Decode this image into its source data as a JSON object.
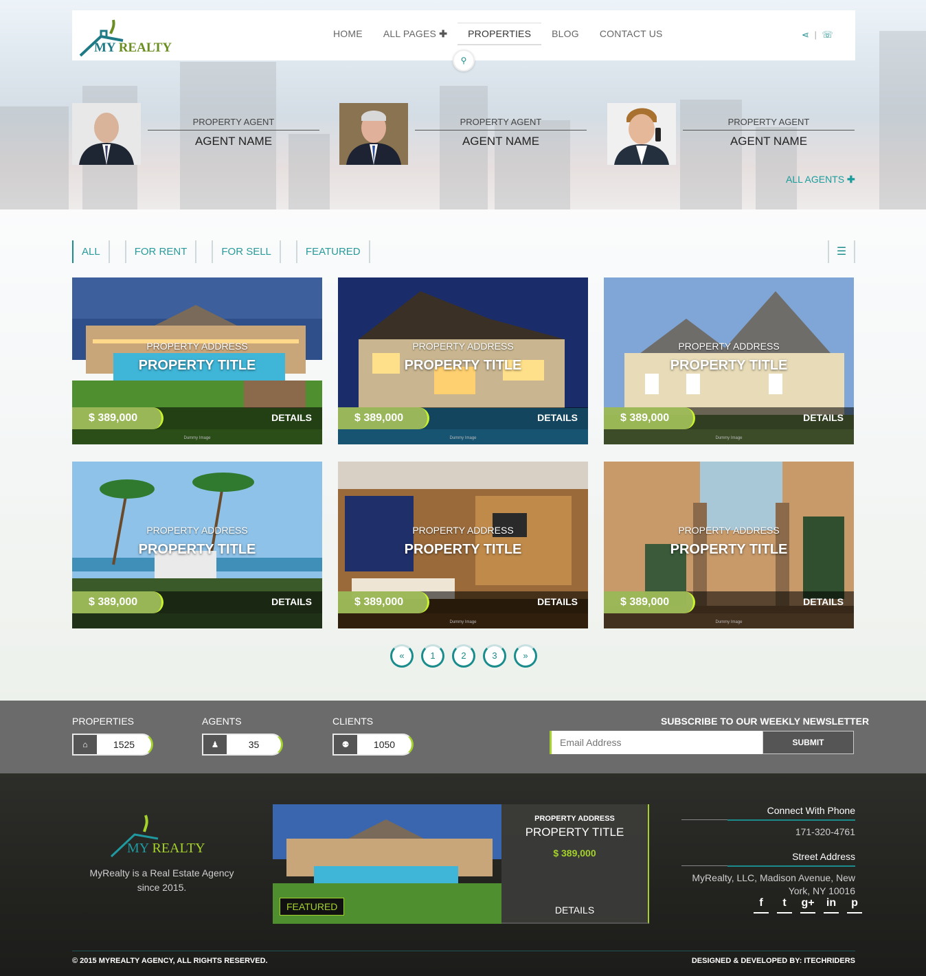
{
  "brand": {
    "name_my": "MY",
    "name_realty": "REALTY"
  },
  "nav": {
    "items": [
      {
        "label": "HOME"
      },
      {
        "label": "ALL PAGES",
        "has_plus": true
      },
      {
        "label": "PROPERTIES",
        "active": true
      },
      {
        "label": "BLOG"
      },
      {
        "label": "CONTACT US"
      }
    ],
    "divider": "|"
  },
  "agents": [
    {
      "role": "PROPERTY AGENT",
      "name": "AGENT NAME"
    },
    {
      "role": "PROPERTY AGENT",
      "name": "AGENT NAME"
    },
    {
      "role": "PROPERTY AGENT",
      "name": "AGENT NAME"
    }
  ],
  "all_agents": {
    "label": "ALL AGENTS"
  },
  "filters": [
    {
      "label": "ALL",
      "active": true
    },
    {
      "label": "FOR RENT"
    },
    {
      "label": "FOR SELL"
    },
    {
      "label": "FEATURED"
    }
  ],
  "properties": [
    {
      "address": "PROPERTY ADDRESS",
      "title": "PROPERTY TITLE",
      "price": "$ 389,000",
      "details": "DETAILS",
      "caption": "Dummy Image"
    },
    {
      "address": "PROPERTY ADDRESS",
      "title": "PROPERTY TITLE",
      "price": "$ 389,000",
      "details": "DETAILS",
      "caption": "Dummy Image"
    },
    {
      "address": "PROPERTY ADDRESS",
      "title": "PROPERTY TITLE",
      "price": "$ 389,000",
      "details": "DETAILS",
      "caption": "Dummy Image"
    },
    {
      "address": "PROPERTY ADDRESS",
      "title": "PROPERTY TITLE",
      "price": "$ 389,000",
      "details": "DETAILS",
      "caption": ""
    },
    {
      "address": "PROPERTY ADDRESS",
      "title": "PROPERTY TITLE",
      "price": "$ 389,000",
      "details": "DETAILS",
      "caption": "Dummy Image"
    },
    {
      "address": "PROPERTY ADDRESS",
      "title": "PROPERTY TITLE",
      "price": "$ 389,000",
      "details": "DETAILS",
      "caption": "Dummy Image"
    }
  ],
  "pagination": {
    "prev": "«",
    "pages": [
      "1",
      "2",
      "3"
    ],
    "next": "»"
  },
  "stats": [
    {
      "label": "PROPERTIES",
      "value": "1525",
      "icon": "home-icon",
      "glyph": "⌂"
    },
    {
      "label": "AGENTS",
      "value": "35",
      "icon": "person-icon",
      "glyph": "♟"
    },
    {
      "label": "CLIENTS",
      "value": "1050",
      "icon": "group-icon",
      "glyph": "⚉"
    }
  ],
  "newsletter": {
    "title": "SUBSCRIBE TO OUR WEEKLY NEWSLETTER",
    "placeholder": "Email Address",
    "button": "SUBMIT"
  },
  "footer": {
    "about": "MyRealty is a Real Estate Agency since 2015.",
    "featured": {
      "badge": "FEATURED",
      "address": "PROPERTY ADDRESS",
      "title": "PROPERTY TITLE",
      "price": "$ 389,000",
      "details": "DETAILS"
    },
    "phone_heading": "Connect With Phone",
    "phone": "171-320-4761",
    "address_heading": "Street Address",
    "address": "MyRealty, LLC, Madison Avenue, New York, NY 10016",
    "social": [
      {
        "icon": "facebook-icon",
        "glyph": "f"
      },
      {
        "icon": "twitter-icon",
        "glyph": "t"
      },
      {
        "icon": "google-plus-icon",
        "glyph": "g+"
      },
      {
        "icon": "linkedin-icon",
        "glyph": "in"
      },
      {
        "icon": "pinterest-icon",
        "glyph": "p"
      }
    ],
    "copyright": "© 2015 MYREALTY AGENCY, ALL RIGHTS RESERVED.",
    "designed": "DESIGNED & DEVELOPED BY: ITECHRIDERS"
  },
  "colors": {
    "accent": "#1a8c8c",
    "lime": "#a4d22b",
    "price_bg": "#9dbb5a"
  }
}
